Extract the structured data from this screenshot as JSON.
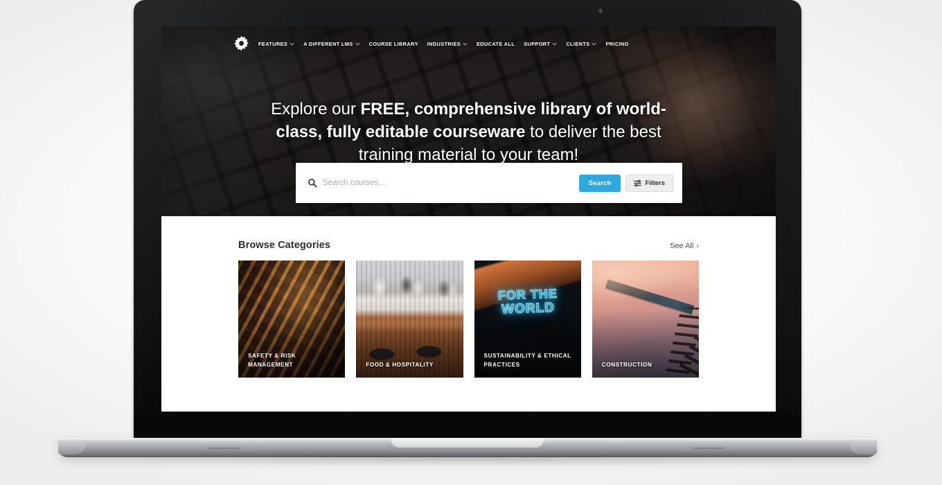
{
  "site": {
    "logo_icon": "gear-icon",
    "nav": [
      {
        "label": "FEATURES",
        "has_dropdown": true
      },
      {
        "label": "A DIFFERENT LMS",
        "has_dropdown": true
      },
      {
        "label": "COURSE LIBRARY",
        "has_dropdown": false
      },
      {
        "label": "INDUSTRIES",
        "has_dropdown": true
      },
      {
        "label": "EDUCATE ALL",
        "has_dropdown": false
      },
      {
        "label": "SUPPORT",
        "has_dropdown": true
      },
      {
        "label": "CLIENTS",
        "has_dropdown": true
      },
      {
        "label": "PRICING",
        "has_dropdown": false
      }
    ]
  },
  "hero": {
    "headline_part1": "Explore our ",
    "headline_strong1": "FREE, comprehensive library of world-class, fully editable courseware",
    "headline_part2": " to deliver the best training material to your team!"
  },
  "search": {
    "icon": "search-icon",
    "value": "",
    "placeholder": "Search courses...",
    "search_button_label": "Search",
    "filters_button_label": "Filters",
    "filters_icon": "sliders-icon",
    "accent_color": "#2BA9E0"
  },
  "browse": {
    "title": "Browse Categories",
    "see_all_label": "See All",
    "see_all_chevron": "›",
    "cards": [
      {
        "label": "SAFETY & RISK MANAGEMENT",
        "image": "industrial-metal-staircase"
      },
      {
        "label": "FOOD & HOSPITALITY",
        "image": "cafe-bar-counter-with-stools"
      },
      {
        "label": "SUSTAINABILITY & ETHICAL PRACTICES",
        "image": "neon-sign-for-the-world",
        "neon_line1": "FOR THE",
        "neon_line2": "WORLD"
      },
      {
        "label": "CONSTRUCTION",
        "image": "tower-crane-at-sunset"
      }
    ]
  },
  "device": {
    "type": "laptop-mockup",
    "webcam": "webcam-dot"
  }
}
